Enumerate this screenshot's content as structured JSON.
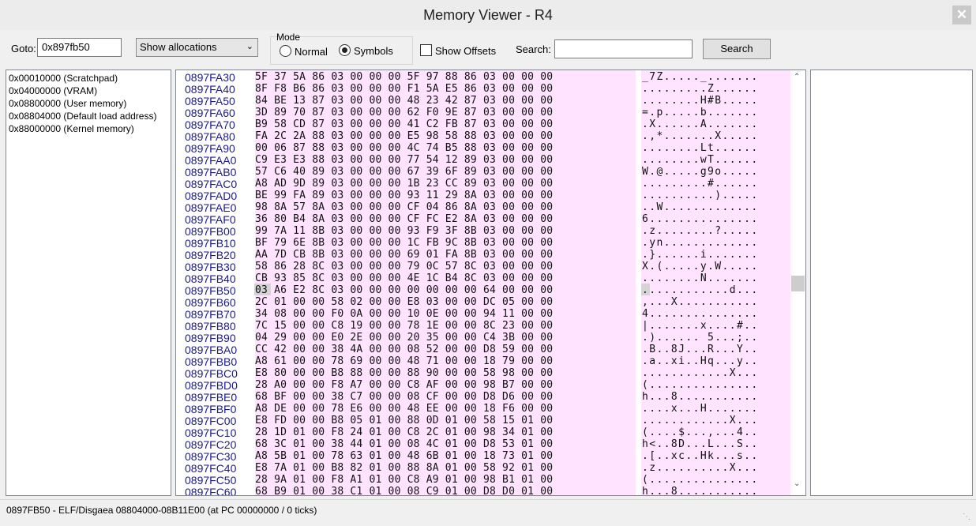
{
  "window": {
    "title": "Memory Viewer - R4",
    "close_glyph": "✕"
  },
  "toolbar": {
    "goto_label": "Goto:",
    "goto_value": "0x897fb50",
    "alloc_select": "Show allocations",
    "mode_label": "Mode",
    "mode_normal": "Normal",
    "mode_symbols": "Symbols",
    "mode_selected": "Symbols",
    "show_offsets_label": "Show Offsets",
    "show_offsets_checked": false,
    "search_label": "Search:",
    "search_value": "",
    "search_button": "Search"
  },
  "allocations": [
    "0x00010000 (Scratchpad)",
    "0x04000000 (VRAM)",
    "0x08800000 (User memory)",
    "0x08804000 (Default load address)",
    "0x88000000 (Kernel memory)"
  ],
  "hex_view": {
    "selected_address": "0897FB50",
    "rows": [
      {
        "addr": "0897FA30",
        "bytes": "5F 37 5A 86 03 00 00 00 5F 97 88 86 03 00 00 00",
        "ascii": "_7Z....._......."
      },
      {
        "addr": "0897FA40",
        "bytes": "8F F8 B6 86 03 00 00 00 F1 5A E5 86 03 00 00 00",
        "ascii": ".........Z......"
      },
      {
        "addr": "0897FA50",
        "bytes": "84 BE 13 87 03 00 00 00 48 23 42 87 03 00 00 00",
        "ascii": "........H#B....."
      },
      {
        "addr": "0897FA60",
        "bytes": "3D 89 70 87 03 00 00 00 62 F0 9E 87 03 00 00 00",
        "ascii": "=.p.....b......."
      },
      {
        "addr": "0897FA70",
        "bytes": "B9 58 CD 87 03 00 00 00 41 C2 FB 87 03 00 00 00",
        "ascii": ".X......A......."
      },
      {
        "addr": "0897FA80",
        "bytes": "FA 2C 2A 88 03 00 00 00 E5 98 58 88 03 00 00 00",
        "ascii": ".,*.......X....."
      },
      {
        "addr": "0897FA90",
        "bytes": "00 06 87 88 03 00 00 00 4C 74 B5 88 03 00 00 00",
        "ascii": "........Lt......"
      },
      {
        "addr": "0897FAA0",
        "bytes": "C9 E3 E3 88 03 00 00 00 77 54 12 89 03 00 00 00",
        "ascii": "........wT......"
      },
      {
        "addr": "0897FAB0",
        "bytes": "57 C6 40 89 03 00 00 00 67 39 6F 89 03 00 00 00",
        "ascii": "W.@.....g9o....."
      },
      {
        "addr": "0897FAC0",
        "bytes": "A8 AD 9D 89 03 00 00 00 1B 23 CC 89 03 00 00 00",
        "ascii": ".........#......"
      },
      {
        "addr": "0897FAD0",
        "bytes": "BE 99 FA 89 03 00 00 00 93 11 29 8A 03 00 00 00",
        "ascii": "..........)....."
      },
      {
        "addr": "0897FAE0",
        "bytes": "98 8A 57 8A 03 00 00 00 CF 04 86 8A 03 00 00 00",
        "ascii": "..W............."
      },
      {
        "addr": "0897FAF0",
        "bytes": "36 80 B4 8A 03 00 00 00 CF FC E2 8A 03 00 00 00",
        "ascii": "6..............."
      },
      {
        "addr": "0897FB00",
        "bytes": "99 7A 11 8B 03 00 00 00 93 F9 3F 8B 03 00 00 00",
        "ascii": ".z........?....."
      },
      {
        "addr": "0897FB10",
        "bytes": "BF 79 6E 8B 03 00 00 00 1C FB 9C 8B 03 00 00 00",
        "ascii": ".yn............."
      },
      {
        "addr": "0897FB20",
        "bytes": "AA 7D CB 8B 03 00 00 00 69 01 FA 8B 03 00 00 00",
        "ascii": ".}......i......."
      },
      {
        "addr": "0897FB30",
        "bytes": "58 86 28 8C 03 00 00 00 79 0C 57 8C 03 00 00 00",
        "ascii": "X.(.....y.W....."
      },
      {
        "addr": "0897FB40",
        "bytes": "CB 93 85 8C 03 00 00 00 4E 1C B4 8C 03 00 00 00",
        "ascii": "........N......."
      },
      {
        "addr": "0897FB50",
        "bytes": "03 A6 E2 8C 03 00 00 00 00 00 00 00 64 00 00 00",
        "ascii": "............d..."
      },
      {
        "addr": "0897FB60",
        "bytes": "2C 01 00 00 58 02 00 00 E8 03 00 00 DC 05 00 00",
        "ascii": ",...X..........."
      },
      {
        "addr": "0897FB70",
        "bytes": "34 08 00 00 F0 0A 00 00 10 0E 00 00 94 11 00 00",
        "ascii": "4..............."
      },
      {
        "addr": "0897FB80",
        "bytes": "7C 15 00 00 C8 19 00 00 78 1E 00 00 8C 23 00 00",
        "ascii": "|.......x....#.."
      },
      {
        "addr": "0897FB90",
        "bytes": "04 29 00 00 E0 2E 00 00 20 35 00 00 C4 3B 00 00",
        "ascii": ".)...... 5...;.."
      },
      {
        "addr": "0897FBA0",
        "bytes": "CC 42 00 00 38 4A 00 00 08 52 00 00 D8 59 00 00",
        "ascii": ".B..8J...R...Y.."
      },
      {
        "addr": "0897FBB0",
        "bytes": "A8 61 00 00 78 69 00 00 48 71 00 00 18 79 00 00",
        "ascii": ".a..xi..Hq...y.."
      },
      {
        "addr": "0897FBC0",
        "bytes": "E8 80 00 00 B8 88 00 00 88 90 00 00 58 98 00 00",
        "ascii": "............X..."
      },
      {
        "addr": "0897FBD0",
        "bytes": "28 A0 00 00 F8 A7 00 00 C8 AF 00 00 98 B7 00 00",
        "ascii": "(..............."
      },
      {
        "addr": "0897FBE0",
        "bytes": "68 BF 00 00 38 C7 00 00 08 CF 00 00 D8 D6 00 00",
        "ascii": "h...8..........."
      },
      {
        "addr": "0897FBF0",
        "bytes": "A8 DE 00 00 78 E6 00 00 48 EE 00 00 18 F6 00 00",
        "ascii": "....x...H......."
      },
      {
        "addr": "0897FC00",
        "bytes": "E8 FD 00 00 B8 05 01 00 88 0D 01 00 58 15 01 00",
        "ascii": "............X..."
      },
      {
        "addr": "0897FC10",
        "bytes": "28 1D 01 00 F8 24 01 00 C8 2C 01 00 98 34 01 00",
        "ascii": "(....$...,...4.."
      },
      {
        "addr": "0897FC20",
        "bytes": "68 3C 01 00 38 44 01 00 08 4C 01 00 D8 53 01 00",
        "ascii": "h<..8D...L...S.."
      },
      {
        "addr": "0897FC30",
        "bytes": "A8 5B 01 00 78 63 01 00 48 6B 01 00 18 73 01 00",
        "ascii": ".[..xc..Hk...s.."
      },
      {
        "addr": "0897FC40",
        "bytes": "E8 7A 01 00 B8 82 01 00 88 8A 01 00 58 92 01 00",
        "ascii": ".z..........X..."
      },
      {
        "addr": "0897FC50",
        "bytes": "28 9A 01 00 F8 A1 01 00 C8 A9 01 00 98 B1 01 00",
        "ascii": "(..............."
      },
      {
        "addr": "0897FC60",
        "bytes": "68 B9 01 00 38 C1 01 00 08 C9 01 00 D8 D0 01 00",
        "ascii": "h...8..........."
      }
    ]
  },
  "status": {
    "text": "0897FB50 - ELF/Disgaea 08804000-08B11E00 (at PC 00000000 / 0 ticks)"
  },
  "colors": {
    "hex_bg": "#ffe3ff",
    "address": "#1a1a8c"
  }
}
